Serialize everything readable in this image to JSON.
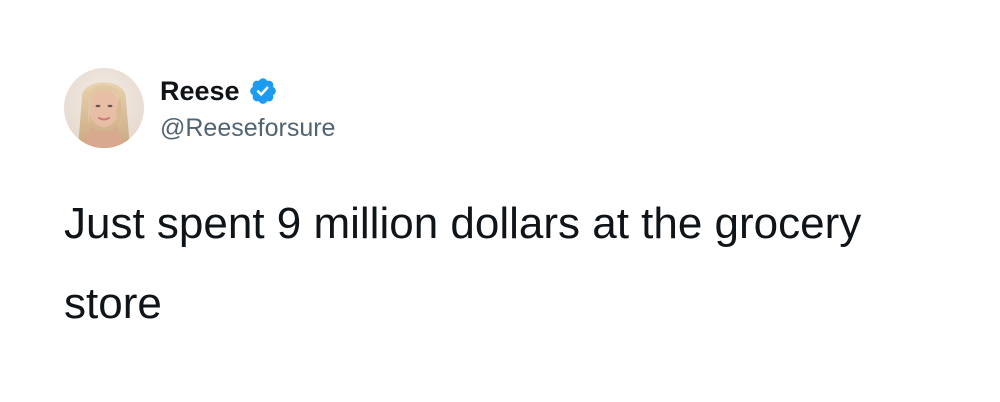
{
  "author": {
    "display_name": "Reese",
    "handle": "@Reeseforsure",
    "verified": true,
    "avatar_icon": "profile-photo-avatar"
  },
  "tweet": {
    "text": "Just spent 9 million dollars at the grocery store"
  },
  "colors": {
    "verified_badge": "#1d9bf0",
    "name_text": "#0f1419",
    "handle_text": "#536471",
    "background": "#ffffff"
  }
}
